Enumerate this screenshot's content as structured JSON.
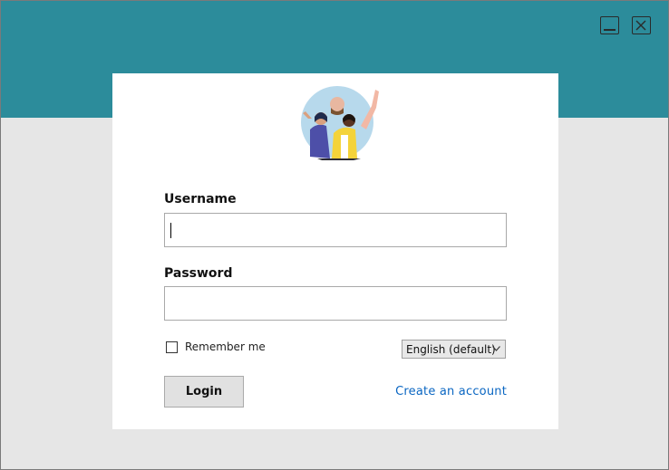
{
  "window": {
    "minimize_icon": "minimize-icon",
    "close_icon": "close-icon",
    "header_color": "#2c8c9b"
  },
  "login": {
    "username_label": "Username",
    "username_value": "",
    "password_label": "Password",
    "password_value": "",
    "remember_label": "Remember me",
    "remember_checked": false,
    "language_selected": "English (default)",
    "login_button": "Login",
    "create_account_link": "Create an account",
    "link_color": "#0a66c2"
  }
}
